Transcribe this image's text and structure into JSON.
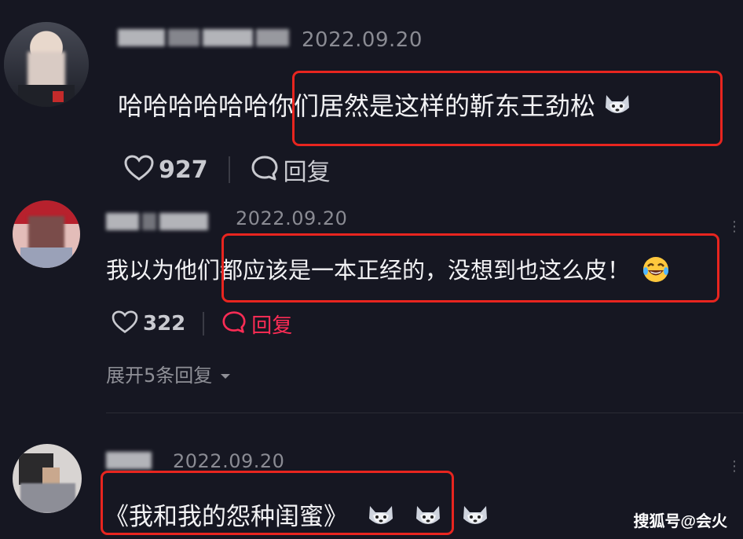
{
  "comments": [
    {
      "date": "2022.09.20",
      "text_plain": "哈哈哈哈哈哈",
      "text_highlight": "你们居然是这样的靳东王劲松",
      "emoji": "husky-emoji",
      "likes": "927",
      "reply_label": "回复"
    },
    {
      "date": "2022.09.20",
      "text_plain": "我以为他们",
      "text_highlight": "都应该是一本正经的，没想到也这么皮！",
      "emoji": "rofl-emoji",
      "likes": "322",
      "reply_label": "回复",
      "reply_active_color": "#fe2c55",
      "expand_label": "展开5条回复"
    },
    {
      "date": "2022.09.20",
      "text_highlight": "《我和我的怨种闺蜜》",
      "emoji": "husky-emoji"
    }
  ],
  "watermark": "搜狐号@会火",
  "colors": {
    "background": "#161722",
    "highlight_box": "#e8251f",
    "active_reply": "#fe2c55"
  }
}
